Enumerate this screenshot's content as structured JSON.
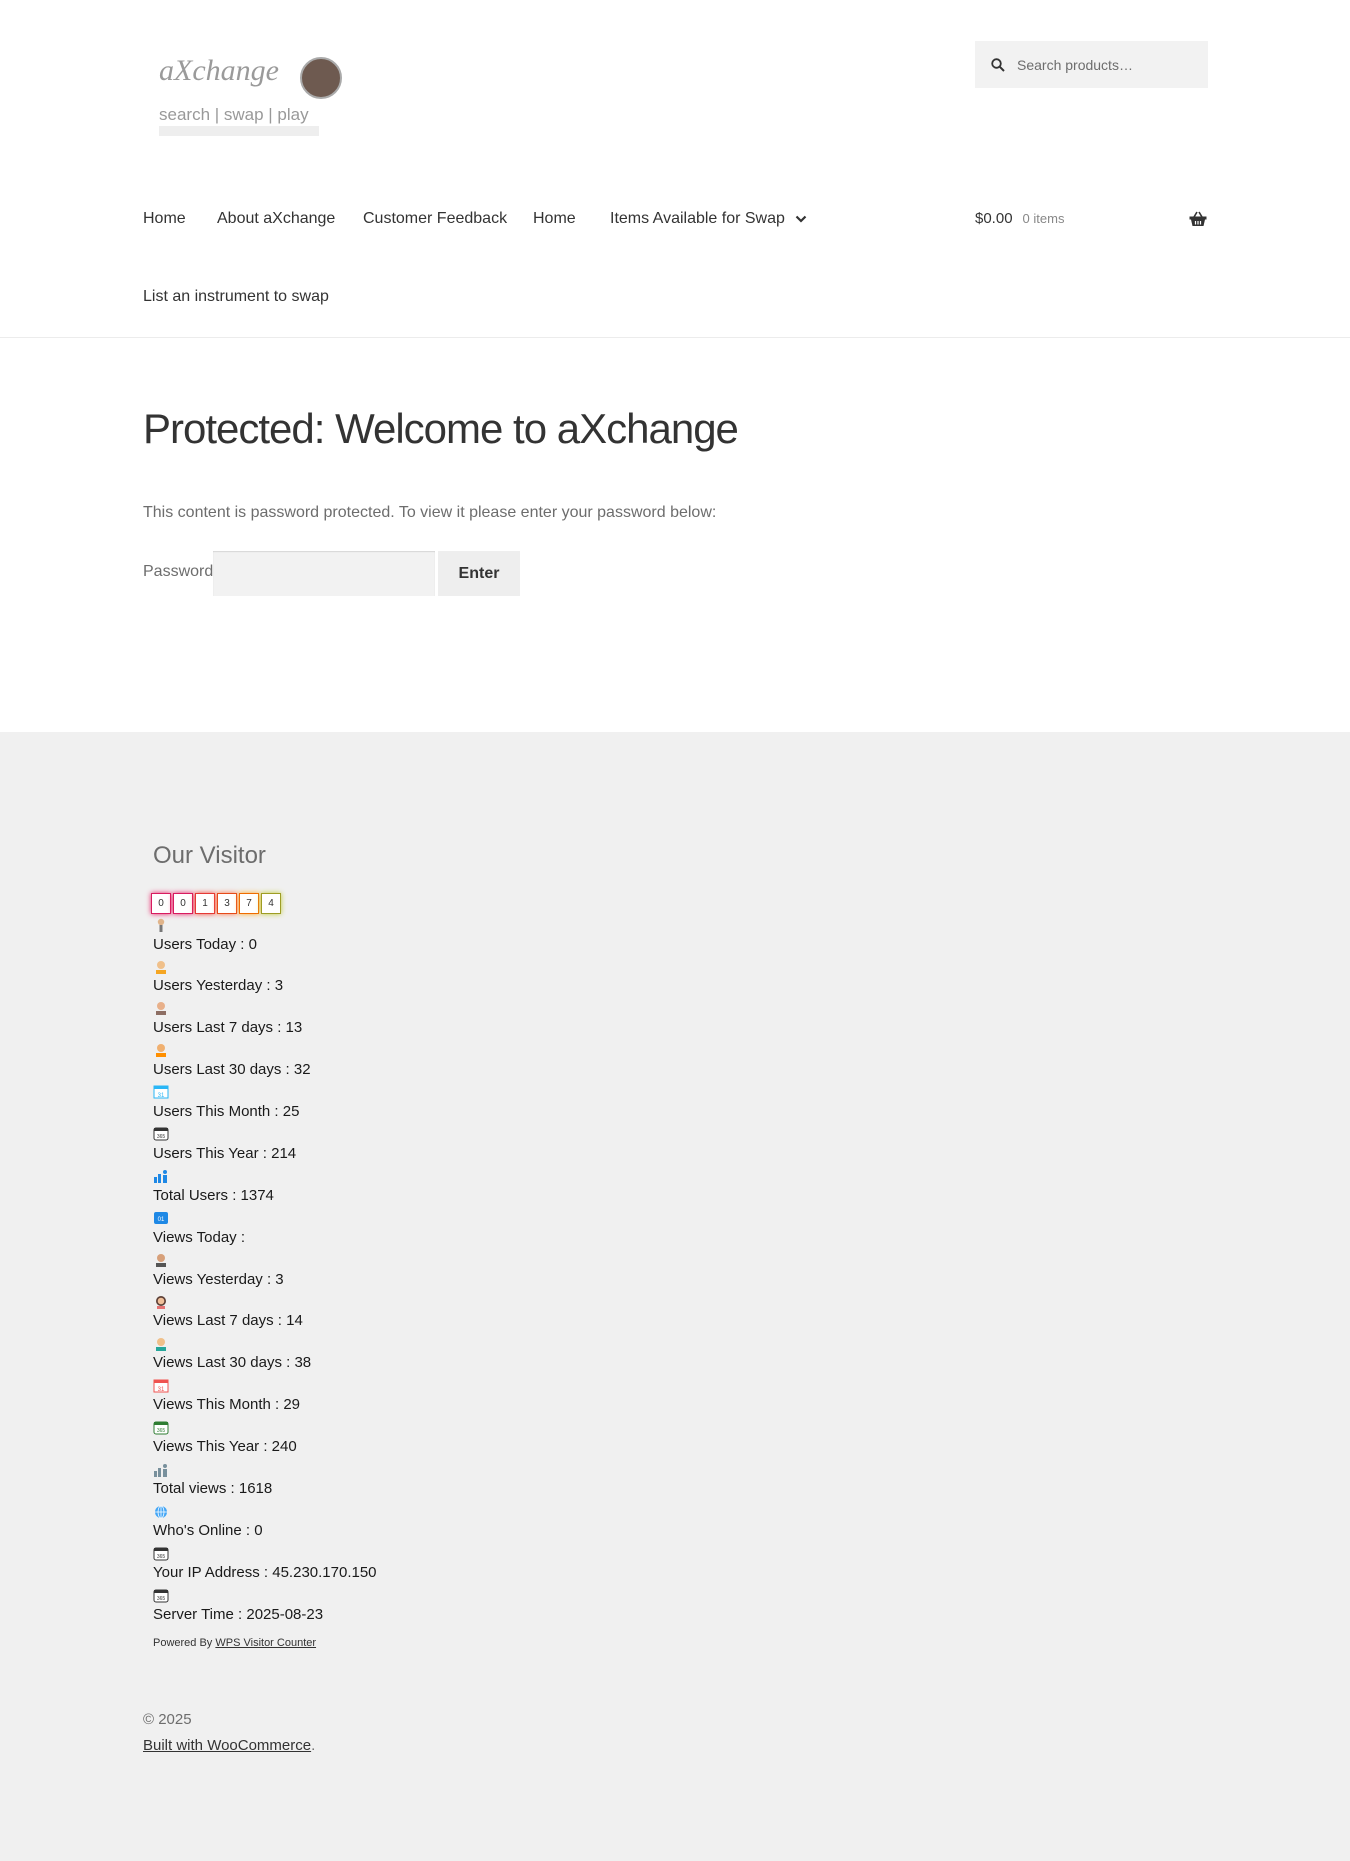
{
  "header": {
    "logo_text": "aXchange",
    "logo_tagline": "search | swap | play",
    "search_placeholder": "Search products…"
  },
  "nav": {
    "items": [
      "Home",
      "About aXchange",
      "Customer Feedback",
      "Home",
      "Items Available for Swap",
      "List an instrument to swap"
    ]
  },
  "cart": {
    "amount": "$0.00",
    "count": "0 items"
  },
  "main": {
    "title": "Protected: Welcome to aXchange",
    "notice": "This content is password protected. To view it please enter your password below:",
    "password_label": "Password:",
    "enter_label": "Enter"
  },
  "footer": {
    "widget_title": "Our Visitor",
    "counter_digits": [
      "0",
      "0",
      "1",
      "3",
      "7",
      "4"
    ],
    "stats": [
      "Users Today : 0",
      "Users Yesterday : 3",
      "Users Last 7 days : 13",
      "Users Last 30 days : 32",
      "Users This Month : 25",
      "Users This Year : 214",
      "Total Users : 1374",
      "Views Today :",
      "Views Yesterday : 3",
      "Views Last 7 days : 14",
      "Views Last 30 days : 38",
      "Views This Month : 29",
      "Views This Year : 240",
      "Total views : 1618",
      "Who's Online : 0",
      "Your IP Address : 45.230.170.150",
      "Server Time : 2025-08-23"
    ],
    "powered_by": "Powered By",
    "powered_link": "WPS Visitor Counter",
    "copyright": "© 2025",
    "built_with": "Built with WooCommerce"
  }
}
